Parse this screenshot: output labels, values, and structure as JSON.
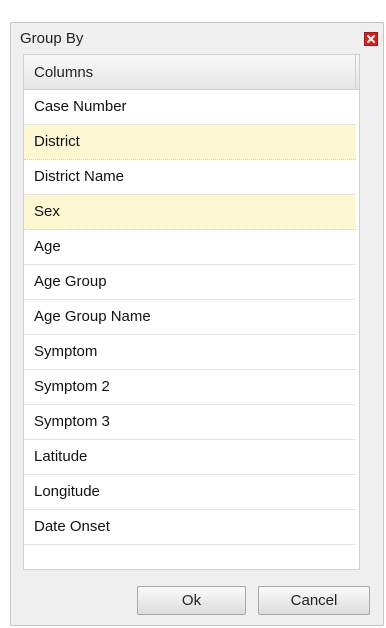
{
  "dialog": {
    "title": "Group By",
    "close_icon": "close-icon",
    "colors": {
      "close": "#d91e1e",
      "selected_row": "#fdf8d2"
    }
  },
  "grid": {
    "header": "Columns",
    "rows": [
      {
        "label": "Case Number",
        "selected": false
      },
      {
        "label": "District",
        "selected": true
      },
      {
        "label": "District Name",
        "selected": false
      },
      {
        "label": "Sex",
        "selected": true
      },
      {
        "label": "Age",
        "selected": false
      },
      {
        "label": "Age Group",
        "selected": false
      },
      {
        "label": "Age Group Name",
        "selected": false
      },
      {
        "label": "Symptom",
        "selected": false
      },
      {
        "label": "Symptom 2",
        "selected": false
      },
      {
        "label": "Symptom 3",
        "selected": false
      },
      {
        "label": "Latitude",
        "selected": false
      },
      {
        "label": "Longitude",
        "selected": false
      },
      {
        "label": "Date Onset",
        "selected": false
      }
    ]
  },
  "buttons": {
    "ok": "Ok",
    "cancel": "Cancel"
  }
}
